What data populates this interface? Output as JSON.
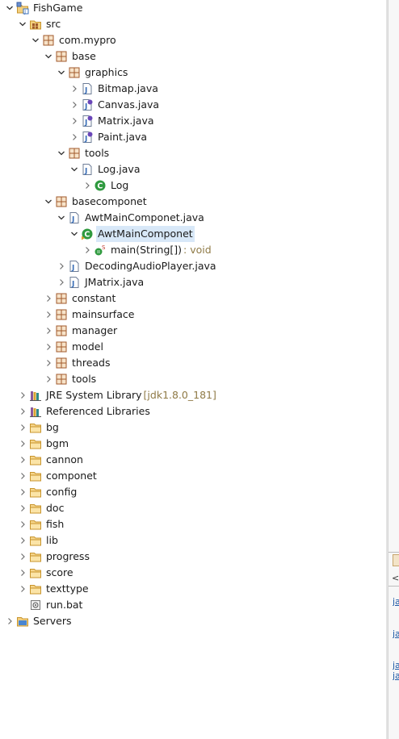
{
  "tree": [
    {
      "label": "FishGame",
      "depth": 0,
      "toggle": "open",
      "icon": "project-icon"
    },
    {
      "label": "src",
      "depth": 1,
      "toggle": "open",
      "icon": "source-folder-icon"
    },
    {
      "label": "com.mypro",
      "depth": 2,
      "toggle": "open",
      "icon": "package-icon"
    },
    {
      "label": "base",
      "depth": 3,
      "toggle": "open",
      "icon": "package-icon"
    },
    {
      "label": "graphics",
      "depth": 4,
      "toggle": "open",
      "icon": "package-icon"
    },
    {
      "label": "Bitmap.java",
      "depth": 5,
      "toggle": "closed",
      "icon": "java-file-icon"
    },
    {
      "label": "Canvas.java",
      "depth": 5,
      "toggle": "closed",
      "icon": "java-interface-file-icon"
    },
    {
      "label": "Matrix.java",
      "depth": 5,
      "toggle": "closed",
      "icon": "java-interface-file-icon"
    },
    {
      "label": "Paint.java",
      "depth": 5,
      "toggle": "closed",
      "icon": "java-interface-file-icon"
    },
    {
      "label": "tools",
      "depth": 4,
      "toggle": "open",
      "icon": "package-icon"
    },
    {
      "label": "Log.java",
      "depth": 5,
      "toggle": "open",
      "icon": "java-file-icon"
    },
    {
      "label": "Log",
      "depth": 6,
      "toggle": "closed",
      "icon": "class-icon"
    },
    {
      "label": "basecomponet",
      "depth": 3,
      "toggle": "open",
      "icon": "package-icon"
    },
    {
      "label": "AwtMainComponet.java",
      "depth": 4,
      "toggle": "open",
      "icon": "java-file-icon"
    },
    {
      "label": "AwtMainComponet",
      "depth": 5,
      "toggle": "open",
      "icon": "main-class-icon",
      "selected": true
    },
    {
      "label": "main(String[])",
      "depth": 6,
      "toggle": "closed",
      "icon": "static-method-icon",
      "suffix": " : void"
    },
    {
      "label": "DecodingAudioPlayer.java",
      "depth": 4,
      "toggle": "closed",
      "icon": "java-file-icon"
    },
    {
      "label": "JMatrix.java",
      "depth": 4,
      "toggle": "closed",
      "icon": "java-file-icon"
    },
    {
      "label": "constant",
      "depth": 3,
      "toggle": "closed",
      "icon": "package-icon"
    },
    {
      "label": "mainsurface",
      "depth": 3,
      "toggle": "closed",
      "icon": "package-icon"
    },
    {
      "label": "manager",
      "depth": 3,
      "toggle": "closed",
      "icon": "package-icon"
    },
    {
      "label": "model",
      "depth": 3,
      "toggle": "closed",
      "icon": "package-icon"
    },
    {
      "label": "threads",
      "depth": 3,
      "toggle": "closed",
      "icon": "package-icon"
    },
    {
      "label": "tools",
      "depth": 3,
      "toggle": "closed",
      "icon": "package-icon"
    },
    {
      "label": "JRE System Library",
      "depth": 1,
      "toggle": "closed",
      "icon": "library-icon",
      "suffix": " [jdk1.8.0_181]"
    },
    {
      "label": "Referenced Libraries",
      "depth": 1,
      "toggle": "closed",
      "icon": "library-icon"
    },
    {
      "label": "bg",
      "depth": 1,
      "toggle": "closed",
      "icon": "folder-icon"
    },
    {
      "label": "bgm",
      "depth": 1,
      "toggle": "closed",
      "icon": "folder-icon"
    },
    {
      "label": "cannon",
      "depth": 1,
      "toggle": "closed",
      "icon": "folder-icon"
    },
    {
      "label": "componet",
      "depth": 1,
      "toggle": "closed",
      "icon": "folder-icon"
    },
    {
      "label": "config",
      "depth": 1,
      "toggle": "closed",
      "icon": "folder-icon"
    },
    {
      "label": "doc",
      "depth": 1,
      "toggle": "closed",
      "icon": "folder-icon"
    },
    {
      "label": "fish",
      "depth": 1,
      "toggle": "closed",
      "icon": "folder-icon"
    },
    {
      "label": "lib",
      "depth": 1,
      "toggle": "closed",
      "icon": "folder-icon"
    },
    {
      "label": "progress",
      "depth": 1,
      "toggle": "closed",
      "icon": "folder-icon"
    },
    {
      "label": "score",
      "depth": 1,
      "toggle": "closed",
      "icon": "folder-icon"
    },
    {
      "label": "texttype",
      "depth": 1,
      "toggle": "closed",
      "icon": "folder-icon"
    },
    {
      "label": "run.bat",
      "depth": 1,
      "toggle": "none",
      "icon": "bat-file-icon"
    },
    {
      "label": "Servers",
      "depth": 0,
      "toggle": "closed",
      "icon": "project-folder-icon"
    }
  ],
  "colors": {
    "package": "#a05a2c",
    "folder": "#e8b04a",
    "java": "#3a6fb8",
    "class": "#2f9a3f",
    "selection": "#d8e8f8",
    "decoration": "#8f7a46"
  },
  "right_panel": {
    "links": [
      "ja",
      "ja",
      "ja",
      "ja"
    ],
    "tag": "<t"
  }
}
